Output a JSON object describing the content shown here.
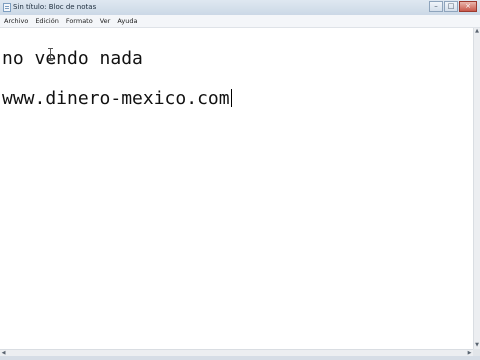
{
  "window": {
    "title": "Sin título: Bloc de notas",
    "controls": {
      "minimize": "–",
      "maximize": "□",
      "close": "×"
    }
  },
  "menubar": {
    "items": [
      {
        "label": "Archivo"
      },
      {
        "label": "Edición"
      },
      {
        "label": "Formato"
      },
      {
        "label": "Ver"
      },
      {
        "label": "Ayuda"
      }
    ]
  },
  "editor": {
    "lines": [
      "no vendo nada",
      "www.dinero-mexico.com"
    ],
    "caret_line": 2
  },
  "scrollbars": {
    "up_glyph": "▲",
    "down_glyph": "▼",
    "left_glyph": "◀",
    "right_glyph": "▶"
  },
  "icons": {
    "app": "notepad-icon",
    "pointer": "text-cursor-icon"
  }
}
